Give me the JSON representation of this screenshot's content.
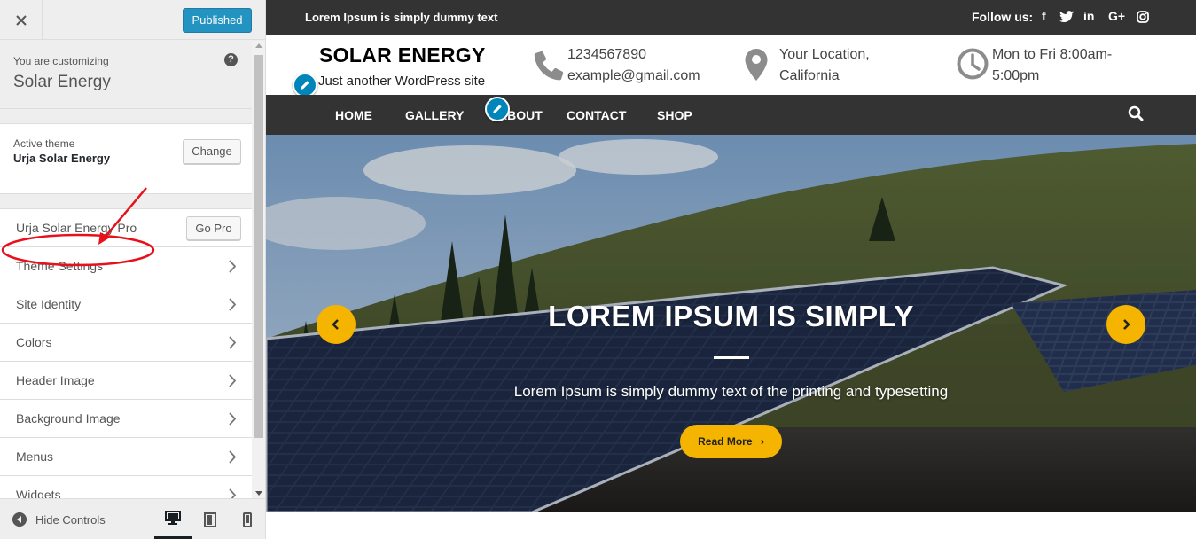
{
  "customizer": {
    "publish_label": "Published",
    "customizing_label": "You are customizing",
    "site_name": "Solar Energy",
    "help_glyph": "?",
    "active_theme_label": "Active theme",
    "active_theme_name": "Urja Solar Energy",
    "change_label": "Change",
    "pro_item_label": "Urja Solar Energy Pro",
    "go_pro_label": "Go Pro",
    "panels": [
      {
        "label": "Theme Settings"
      },
      {
        "label": "Site Identity"
      },
      {
        "label": "Colors"
      },
      {
        "label": "Header Image"
      },
      {
        "label": "Background Image"
      },
      {
        "label": "Menus"
      },
      {
        "label": "Widgets"
      }
    ],
    "hide_controls_label": "Hide Controls",
    "devices": [
      "desktop",
      "tablet",
      "mobile"
    ]
  },
  "preview": {
    "topbar_tagline": "Lorem Ipsum is simply dummy text",
    "follow_label": "Follow us:",
    "social_icons": [
      "facebook-icon",
      "twitter-icon",
      "linkedin-icon",
      "google-plus-icon",
      "instagram-icon"
    ],
    "social_glyphs": [
      "f",
      "",
      "in",
      "G+",
      ""
    ],
    "site_title": "SOLAR ENERGY",
    "site_description": "Just another WordPress site",
    "phone": "1234567890",
    "email": "example@gmail.com",
    "location_line1": "Your Location,",
    "location_line2": "California",
    "hours_line1": "Mon to Fri 8:00am-",
    "hours_line2": "5:00pm",
    "nav": [
      "HOME",
      "GALLERY",
      "ABOUT",
      "CONTACT",
      "SHOP"
    ],
    "slider_title": "LOREM IPSUM IS SIMPLY",
    "slider_text": "Lorem Ipsum is simply dummy text of the printing and typesetting",
    "read_more_label": "Read More",
    "read_more_glyph": "›"
  },
  "colors": {
    "accent": "#f4b400",
    "publish": "#0085ba",
    "dark_bar": "#333333",
    "annotation": "#e8101a"
  }
}
